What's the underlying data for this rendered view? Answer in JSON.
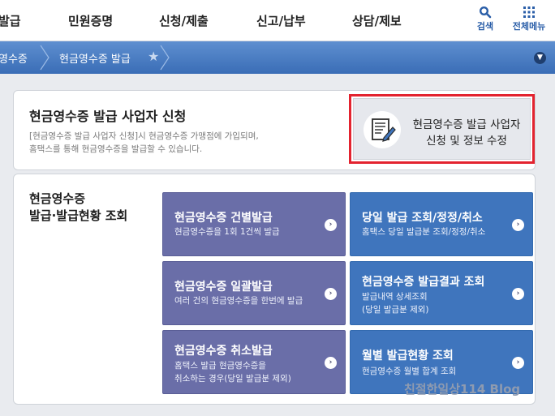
{
  "nav": {
    "items": [
      "발급",
      "민원증명",
      "신청/제출",
      "신고/납부",
      "상담/제보"
    ],
    "search": "검색",
    "menu": "전체메뉴"
  },
  "breadcrumb": {
    "parent": "영수증",
    "current": "현금영수증 발급"
  },
  "apply": {
    "title": "현금영수증 발급 사업자 신청",
    "desc_line1": "[현금영수증 발급 사업자 신청]시 현금영수증 가맹점에 가입되며,",
    "desc_line2": "홈택스를 통해 현금영수증을 발급할 수 있습니다.",
    "button_line1": "현금영수증 발급 사업자",
    "button_line2": "신청 및 정보 수정"
  },
  "lookup": {
    "title_line1": "현금영수증",
    "title_line2": "발급·발급현황 조회"
  },
  "tiles": [
    {
      "title": "현금영수증 건별발급",
      "desc": [
        "현금영수증을 1회 1건씩 발급"
      ]
    },
    {
      "title": "당일 발급 조회/정정/취소",
      "desc": [
        "홈택스 당일 발급분 조회/정정/취소"
      ]
    },
    {
      "title": "현금영수증 일괄발급",
      "desc": [
        "여러 건의 현금영수증을 한번에 발급"
      ]
    },
    {
      "title": "현금영수증 발급결과 조회",
      "desc": [
        "발급내역 상세조회",
        "(당일 발급분 제외)"
      ]
    },
    {
      "title": "현금영수증 취소발급",
      "desc": [
        "홈택스 발급 현금영수증을",
        "취소하는 경우(당일 발급분 제외)"
      ]
    },
    {
      "title": "월별 발급현황 조회",
      "desc": [
        "현금영수증 월별 합계 조회"
      ]
    }
  ],
  "watermark": "친절한일상114 Blog",
  "colors": {
    "purple_tile": "#6a6ea8",
    "blue_tile": "#3f75bd",
    "highlight": "#e3232f"
  },
  "icons": {
    "search": "search-icon",
    "menu": "grid-menu-icon",
    "document": "document-pen-icon",
    "arrow": "chevron-right-icon",
    "star": "star-icon",
    "dropdown": "chevron-down-icon"
  }
}
